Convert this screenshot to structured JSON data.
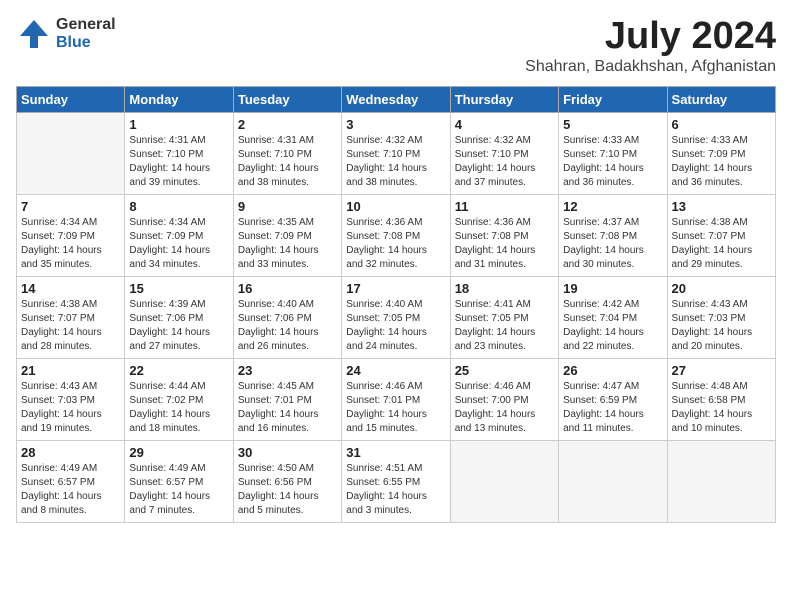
{
  "logo": {
    "general": "General",
    "blue": "Blue",
    "icon": "▶"
  },
  "title": "July 2024",
  "subtitle": "Shahran, Badakhshan, Afghanistan",
  "weekdays": [
    "Sunday",
    "Monday",
    "Tuesday",
    "Wednesday",
    "Thursday",
    "Friday",
    "Saturday"
  ],
  "weeks": [
    [
      {
        "day": "",
        "sunrise": "",
        "sunset": "",
        "daylight": ""
      },
      {
        "day": "1",
        "sunrise": "Sunrise: 4:31 AM",
        "sunset": "Sunset: 7:10 PM",
        "daylight": "Daylight: 14 hours and 39 minutes."
      },
      {
        "day": "2",
        "sunrise": "Sunrise: 4:31 AM",
        "sunset": "Sunset: 7:10 PM",
        "daylight": "Daylight: 14 hours and 38 minutes."
      },
      {
        "day": "3",
        "sunrise": "Sunrise: 4:32 AM",
        "sunset": "Sunset: 7:10 PM",
        "daylight": "Daylight: 14 hours and 38 minutes."
      },
      {
        "day": "4",
        "sunrise": "Sunrise: 4:32 AM",
        "sunset": "Sunset: 7:10 PM",
        "daylight": "Daylight: 14 hours and 37 minutes."
      },
      {
        "day": "5",
        "sunrise": "Sunrise: 4:33 AM",
        "sunset": "Sunset: 7:10 PM",
        "daylight": "Daylight: 14 hours and 36 minutes."
      },
      {
        "day": "6",
        "sunrise": "Sunrise: 4:33 AM",
        "sunset": "Sunset: 7:09 PM",
        "daylight": "Daylight: 14 hours and 36 minutes."
      }
    ],
    [
      {
        "day": "7",
        "sunrise": "Sunrise: 4:34 AM",
        "sunset": "Sunset: 7:09 PM",
        "daylight": "Daylight: 14 hours and 35 minutes."
      },
      {
        "day": "8",
        "sunrise": "Sunrise: 4:34 AM",
        "sunset": "Sunset: 7:09 PM",
        "daylight": "Daylight: 14 hours and 34 minutes."
      },
      {
        "day": "9",
        "sunrise": "Sunrise: 4:35 AM",
        "sunset": "Sunset: 7:09 PM",
        "daylight": "Daylight: 14 hours and 33 minutes."
      },
      {
        "day": "10",
        "sunrise": "Sunrise: 4:36 AM",
        "sunset": "Sunset: 7:08 PM",
        "daylight": "Daylight: 14 hours and 32 minutes."
      },
      {
        "day": "11",
        "sunrise": "Sunrise: 4:36 AM",
        "sunset": "Sunset: 7:08 PM",
        "daylight": "Daylight: 14 hours and 31 minutes."
      },
      {
        "day": "12",
        "sunrise": "Sunrise: 4:37 AM",
        "sunset": "Sunset: 7:08 PM",
        "daylight": "Daylight: 14 hours and 30 minutes."
      },
      {
        "day": "13",
        "sunrise": "Sunrise: 4:38 AM",
        "sunset": "Sunset: 7:07 PM",
        "daylight": "Daylight: 14 hours and 29 minutes."
      }
    ],
    [
      {
        "day": "14",
        "sunrise": "Sunrise: 4:38 AM",
        "sunset": "Sunset: 7:07 PM",
        "daylight": "Daylight: 14 hours and 28 minutes."
      },
      {
        "day": "15",
        "sunrise": "Sunrise: 4:39 AM",
        "sunset": "Sunset: 7:06 PM",
        "daylight": "Daylight: 14 hours and 27 minutes."
      },
      {
        "day": "16",
        "sunrise": "Sunrise: 4:40 AM",
        "sunset": "Sunset: 7:06 PM",
        "daylight": "Daylight: 14 hours and 26 minutes."
      },
      {
        "day": "17",
        "sunrise": "Sunrise: 4:40 AM",
        "sunset": "Sunset: 7:05 PM",
        "daylight": "Daylight: 14 hours and 24 minutes."
      },
      {
        "day": "18",
        "sunrise": "Sunrise: 4:41 AM",
        "sunset": "Sunset: 7:05 PM",
        "daylight": "Daylight: 14 hours and 23 minutes."
      },
      {
        "day": "19",
        "sunrise": "Sunrise: 4:42 AM",
        "sunset": "Sunset: 7:04 PM",
        "daylight": "Daylight: 14 hours and 22 minutes."
      },
      {
        "day": "20",
        "sunrise": "Sunrise: 4:43 AM",
        "sunset": "Sunset: 7:03 PM",
        "daylight": "Daylight: 14 hours and 20 minutes."
      }
    ],
    [
      {
        "day": "21",
        "sunrise": "Sunrise: 4:43 AM",
        "sunset": "Sunset: 7:03 PM",
        "daylight": "Daylight: 14 hours and 19 minutes."
      },
      {
        "day": "22",
        "sunrise": "Sunrise: 4:44 AM",
        "sunset": "Sunset: 7:02 PM",
        "daylight": "Daylight: 14 hours and 18 minutes."
      },
      {
        "day": "23",
        "sunrise": "Sunrise: 4:45 AM",
        "sunset": "Sunset: 7:01 PM",
        "daylight": "Daylight: 14 hours and 16 minutes."
      },
      {
        "day": "24",
        "sunrise": "Sunrise: 4:46 AM",
        "sunset": "Sunset: 7:01 PM",
        "daylight": "Daylight: 14 hours and 15 minutes."
      },
      {
        "day": "25",
        "sunrise": "Sunrise: 4:46 AM",
        "sunset": "Sunset: 7:00 PM",
        "daylight": "Daylight: 14 hours and 13 minutes."
      },
      {
        "day": "26",
        "sunrise": "Sunrise: 4:47 AM",
        "sunset": "Sunset: 6:59 PM",
        "daylight": "Daylight: 14 hours and 11 minutes."
      },
      {
        "day": "27",
        "sunrise": "Sunrise: 4:48 AM",
        "sunset": "Sunset: 6:58 PM",
        "daylight": "Daylight: 14 hours and 10 minutes."
      }
    ],
    [
      {
        "day": "28",
        "sunrise": "Sunrise: 4:49 AM",
        "sunset": "Sunset: 6:57 PM",
        "daylight": "Daylight: 14 hours and 8 minutes."
      },
      {
        "day": "29",
        "sunrise": "Sunrise: 4:49 AM",
        "sunset": "Sunset: 6:57 PM",
        "daylight": "Daylight: 14 hours and 7 minutes."
      },
      {
        "day": "30",
        "sunrise": "Sunrise: 4:50 AM",
        "sunset": "Sunset: 6:56 PM",
        "daylight": "Daylight: 14 hours and 5 minutes."
      },
      {
        "day": "31",
        "sunrise": "Sunrise: 4:51 AM",
        "sunset": "Sunset: 6:55 PM",
        "daylight": "Daylight: 14 hours and 3 minutes."
      },
      {
        "day": "",
        "sunrise": "",
        "sunset": "",
        "daylight": ""
      },
      {
        "day": "",
        "sunrise": "",
        "sunset": "",
        "daylight": ""
      },
      {
        "day": "",
        "sunrise": "",
        "sunset": "",
        "daylight": ""
      }
    ]
  ]
}
